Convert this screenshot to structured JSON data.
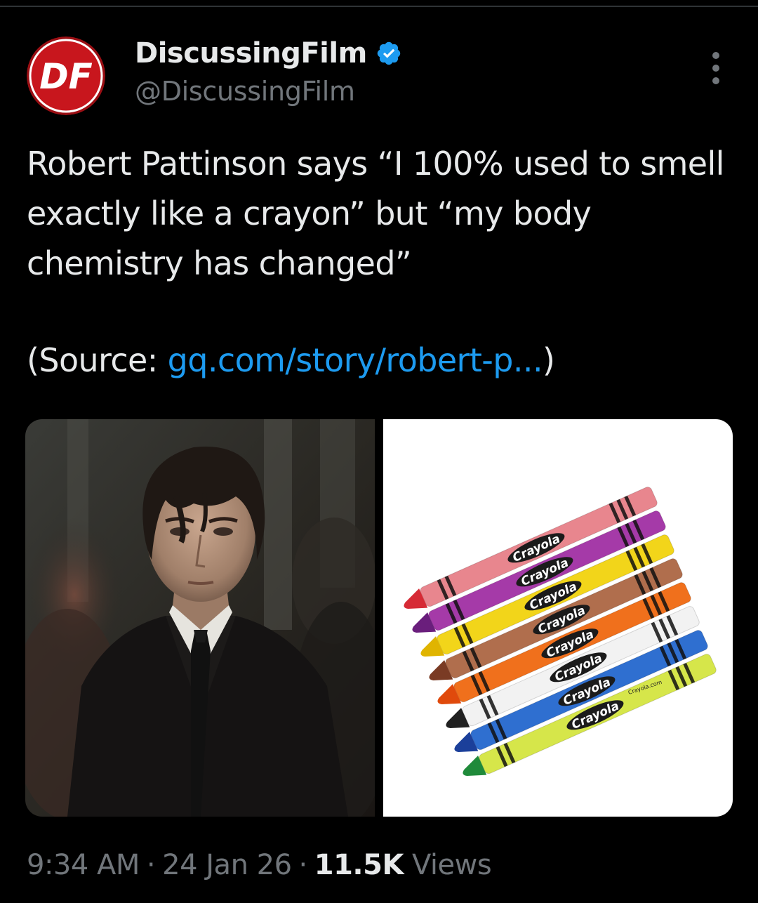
{
  "author": {
    "name": "DiscussingFilm",
    "handle": "@DiscussingFilm",
    "avatar_icon": "df-logo-icon",
    "verified_icon": "verified-badge-icon",
    "logo_text": "DF"
  },
  "more_icon": "more-options-icon",
  "tweet": {
    "text": "Robert Pattinson says “I 100% used to smell exactly like a crayon” but “my body chemistry has changed”",
    "source_prefix": "(Source: ",
    "source_link": "gq.com/story/robert-p...",
    "source_suffix": ")"
  },
  "media": {
    "left_image": "man-in-dark-suit-photo",
    "right_image": "crayola-crayons-photo",
    "crayon_brand": "Crayola",
    "crayon_site": "Crayola.com"
  },
  "meta": {
    "time": "9:34 AM",
    "separator": "·",
    "date": "24 Jan 26",
    "views_count": "11.5K",
    "views_label": "Views"
  },
  "colors": {
    "background": "#000000",
    "text": "#e7e9ea",
    "secondary": "#71767b",
    "link": "#1d9bf0",
    "verified": "#1d9bf0",
    "logo_red": "#c8161d"
  }
}
